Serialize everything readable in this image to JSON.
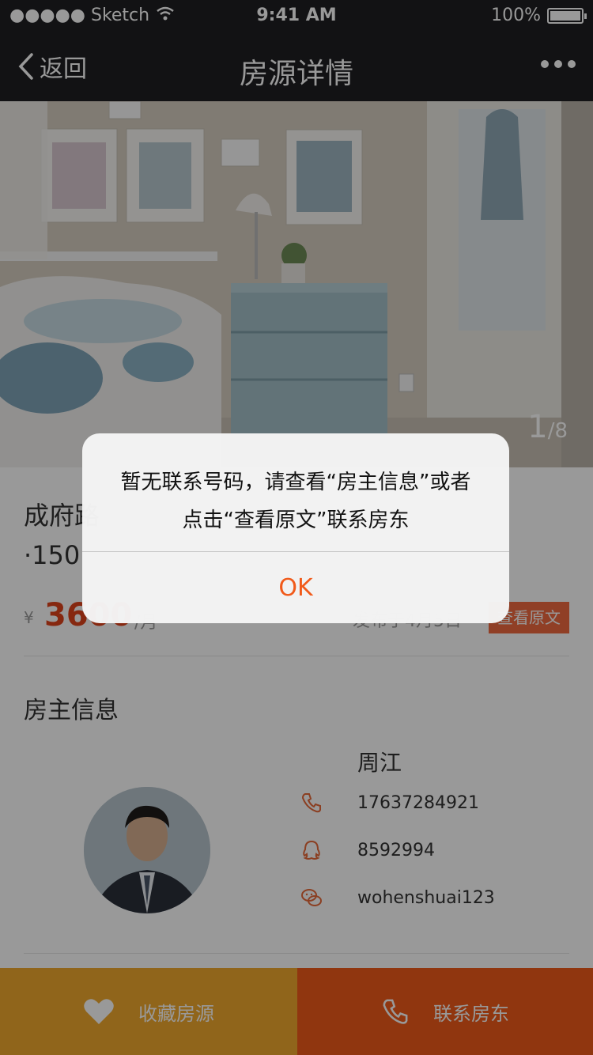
{
  "status_bar": {
    "carrier": "●●●●● Sketch",
    "time": "9:41 AM",
    "battery": "100%"
  },
  "nav": {
    "back_label": "返回",
    "title": "房源详情"
  },
  "gallery": {
    "current": "1",
    "total": "/8"
  },
  "listing": {
    "title_partial": "成府路",
    "subtitle_partial": "·150",
    "currency": "¥",
    "price": "3600",
    "price_unit": "/月",
    "published": "发布于4月5日",
    "view_original": "查看原文"
  },
  "landlord": {
    "section_title": "房主信息",
    "name": "周江",
    "phone": "17637284921",
    "qq": "8592994",
    "wechat": "wohenshuai123"
  },
  "actions": {
    "favorite": "收藏房源",
    "contact": "联系房东"
  },
  "alert": {
    "message_line1": "暂无联系号码，请查看“房主信息”或者",
    "message_line2": "点击“查看原文”联系房东",
    "ok": "OK"
  },
  "colors": {
    "accent": "#f15a1a",
    "favorite_bg": "#f1a82d",
    "nav_bg": "#1e1f22"
  }
}
